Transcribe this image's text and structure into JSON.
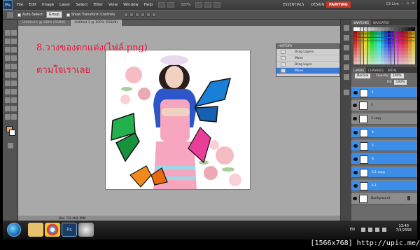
{
  "app": {
    "logo": "Ps",
    "menu": [
      "File",
      "Edit",
      "Image",
      "Layer",
      "Select",
      "Filter",
      "View",
      "Window",
      "Help"
    ],
    "zoom": "100%",
    "workspaces": [
      "ESSENTIALS",
      "DESIGN",
      "PAINTING"
    ],
    "active_workspace": "PAINTING",
    "cs_live": "CS Live"
  },
  "options": {
    "auto_select_label": "Auto-Select:",
    "auto_select_value": "Group",
    "transform_label": "Show Transform Controls"
  },
  "tabs": [
    "Untitled-1 @ 100% (RGB/8)",
    "Untitled-2 @ 100% (RGB/8)"
  ],
  "annotation": {
    "line1": "8.วางของตกแต่ง(ไฟล์.png)",
    "line2": "ตามใจเราเลย"
  },
  "history": {
    "title": "HISTORY",
    "items": [
      "Drag Layers",
      "Move",
      "Drag Layer",
      "Move"
    ]
  },
  "right_panel": {
    "swatch_tabs": [
      "SWATCHES",
      "NAVIGATOR"
    ],
    "layer_tabs": [
      "LAYERS",
      "CHANNELS",
      "PATHS"
    ],
    "blend_mode": "Normal",
    "opacity_label": "Opacity:",
    "opacity_value": "100%",
    "fill_label": "Fill:",
    "fill_value": "100%",
    "layers": [
      {
        "name": "1",
        "selected": true
      },
      {
        "name": "3",
        "selected": false
      },
      {
        "name": "3 copy",
        "selected": false
      },
      {
        "name": "4",
        "selected": true
      },
      {
        "name": "5",
        "selected": true
      },
      {
        "name": "6",
        "selected": true
      },
      {
        "name": "6.1 copy",
        "selected": true
      },
      {
        "name": "6.1",
        "selected": true
      },
      {
        "name": "Background",
        "selected": false
      }
    ]
  },
  "status": {
    "doc": "Doc: 732.4K/6.99M"
  },
  "taskbar": {
    "lang": "EN",
    "time": "13:40",
    "date": "7/3/2558"
  },
  "watermark": "[1566x768] http://upic.me/"
}
